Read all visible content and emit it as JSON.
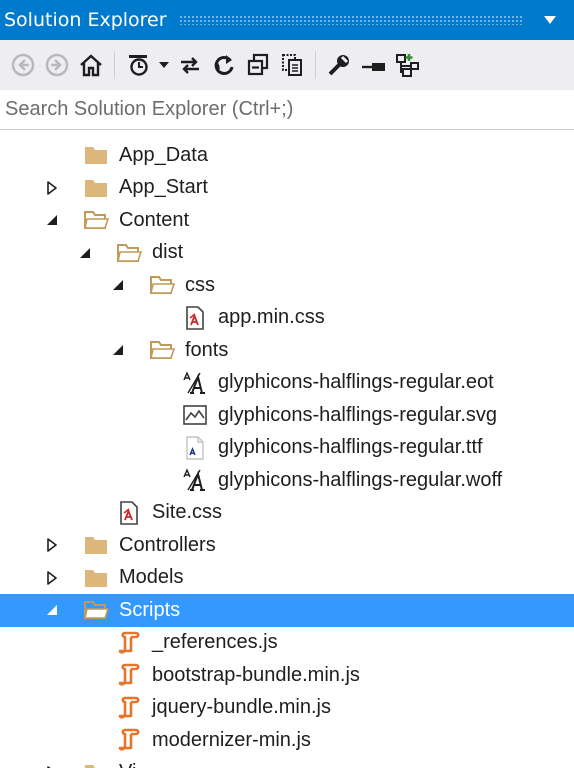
{
  "panel": {
    "title": "Solution Explorer"
  },
  "search": {
    "placeholder": "Search Solution Explorer (Ctrl+;)"
  },
  "colors": {
    "accent": "#007acc",
    "selection": "#3399ff",
    "folder": "#dcb67a",
    "script": "#e8742c",
    "css": "#c82b2b"
  },
  "toolbar": [
    "back-icon",
    "forward-icon",
    "home-icon",
    "pending-changes-icon",
    "dropdown-arrow-icon",
    "sync-icon",
    "refresh-icon",
    "collapse-all-icon",
    "show-all-files-icon",
    "properties-icon",
    "preview-icon",
    "class-view-icon"
  ],
  "tree": [
    {
      "label": "App_Data",
      "icon": "folder-icon",
      "expander": "none"
    },
    {
      "label": "App_Start",
      "icon": "folder-icon",
      "expander": "collapsed"
    },
    {
      "label": "Content",
      "icon": "folder-open-icon",
      "expander": "expanded"
    },
    {
      "label": "dist",
      "icon": "folder-open-icon",
      "expander": "expanded"
    },
    {
      "label": "css",
      "icon": "folder-open-icon",
      "expander": "expanded"
    },
    {
      "label": "app.min.css",
      "icon": "css-file-icon",
      "expander": "none"
    },
    {
      "label": "fonts",
      "icon": "folder-open-icon",
      "expander": "expanded"
    },
    {
      "label": "glyphicons-halflings-regular.eot",
      "icon": "font-file-icon",
      "expander": "none"
    },
    {
      "label": "glyphicons-halflings-regular.svg",
      "icon": "image-file-icon",
      "expander": "none"
    },
    {
      "label": "glyphicons-halflings-regular.ttf",
      "icon": "truetype-file-icon",
      "expander": "none"
    },
    {
      "label": "glyphicons-halflings-regular.woff",
      "icon": "font-file-icon",
      "expander": "none"
    },
    {
      "label": "Site.css",
      "icon": "css-file-icon",
      "expander": "none"
    },
    {
      "label": "Controllers",
      "icon": "folder-icon",
      "expander": "collapsed"
    },
    {
      "label": "Models",
      "icon": "folder-icon",
      "expander": "collapsed"
    },
    {
      "label": "Scripts",
      "icon": "folder-open-icon",
      "expander": "expanded",
      "selected": true
    },
    {
      "label": "_references.js",
      "icon": "js-file-icon",
      "expander": "none"
    },
    {
      "label": "bootstrap-bundle.min.js",
      "icon": "js-file-icon",
      "expander": "none"
    },
    {
      "label": "jquery-bundle.min.js",
      "icon": "js-file-icon",
      "expander": "none"
    },
    {
      "label": "modernizer-min.js",
      "icon": "js-file-icon",
      "expander": "none"
    },
    {
      "label": "Vi",
      "icon": "folder-icon",
      "expander": "collapsed"
    }
  ]
}
